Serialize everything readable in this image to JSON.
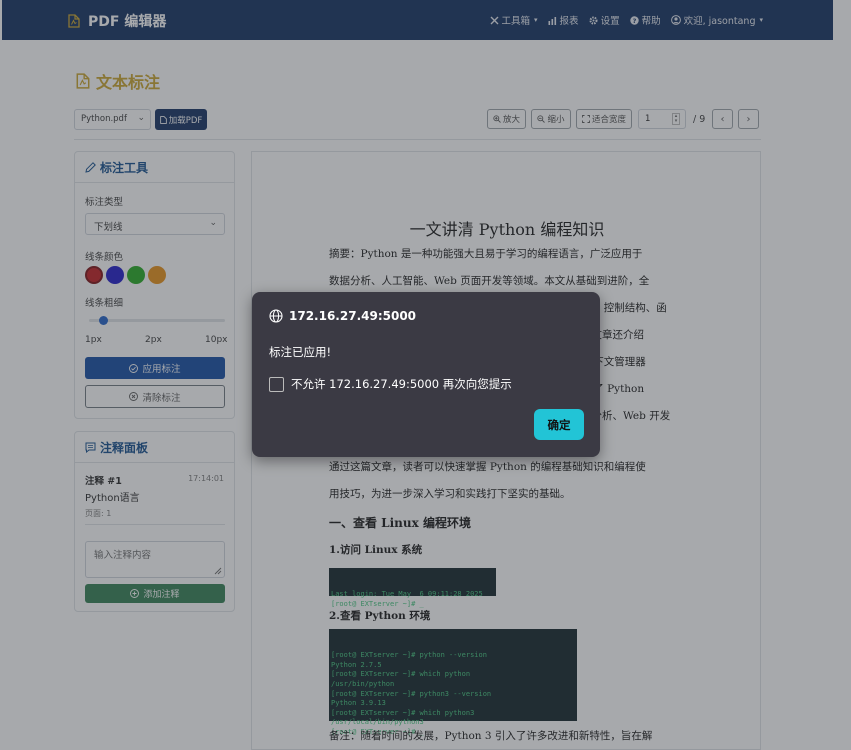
{
  "navbar": {
    "brand": "PDF 编辑器",
    "items": [
      {
        "label": "工具箱",
        "icon": "tools-icon",
        "caret": "▾"
      },
      {
        "label": "报表",
        "icon": "chart-bar-icon"
      },
      {
        "label": "设置",
        "icon": "gear-icon"
      },
      {
        "label": "帮助",
        "icon": "question-circle-icon"
      },
      {
        "label": "欢迎, jasontang",
        "icon": "user-circle-icon",
        "caret": "▾"
      }
    ]
  },
  "page": {
    "title": "文本标注"
  },
  "toolbar": {
    "file_select": "Python.pdf",
    "load_button": "加载PDF",
    "zoom_in": "放大",
    "zoom_out": "缩小",
    "fit_width": "适合宽度",
    "page_value": "1",
    "page_total": "/ 9",
    "prev": "‹",
    "next": "›"
  },
  "annotation_tools": {
    "heading": "标注工具",
    "type_label": "标注类型",
    "type_value": "下划线",
    "color_label": "线条颜色",
    "colors": [
      "#c0161b",
      "#1a14c8",
      "#1fa81c",
      "#e88f12"
    ],
    "width_label": "线条粗细",
    "width_ticks": [
      "1px",
      "2px",
      "10px"
    ],
    "apply_button": "应用标注",
    "clear_button": "清除标注"
  },
  "notes_panel": {
    "heading": "注释面板",
    "note": {
      "title": "注释 #1",
      "time": "17:14:01",
      "text": "Python语言",
      "page": "页面: 1"
    },
    "input_placeholder": "输入注释内容",
    "add_button": "添加注释"
  },
  "document": {
    "title": "一文讲清 Python 编程知识",
    "abstract_lines": [
      "摘要：Python  是一种功能强大且易于学习的编程语言，广泛应用于",
      "数据分析、人工智能、Web 页面开发等领域。本文从基础到进阶，全",
      "面介绍了 Python 的核心知识，包括基础语法、数据类型、控制结构、函",
      "数定义、面向对象编程、模块与包、异常处理等。同时，文章还介绍",
      "了 Python 的高级特性，如生成器、装饰器、迭代器、上下文管理器",
      "等，帮助读者深入理解 Python 的编程思想。此外还探讨了 Python",
      "在实际项目中的应用，例如网络爬虫、自动化脚本、数据分析、Web 开发",
      "等领域的实战案例。"
    ],
    "summary_lines": [
      "通过这篇文章，读者可以快速掌握 Python 的编程基础知识和编程使",
      "用技巧，为进一步深入学习和实践打下坚实的基础。"
    ],
    "section1": "一、查看 Linux 编程环境",
    "sub1": "1.访问 Linux 系统",
    "term1": [
      "Last login: Tue May  6 09:11:28 2025",
      "[root@ EXTserver ~]# _"
    ],
    "sub2": "2.查看 Python 环境",
    "term2": [
      "[root@ EXTserver ~]# python --version",
      "Python 2.7.5",
      "[root@ EXTserver ~]# which python",
      "/usr/bin/python",
      "[root@ EXTserver ~]# python3 --version",
      "Python 3.9.13",
      "[root@ EXTserver ~]# which python3",
      "/usr/local/bin/python3",
      "[root@ EXTserver ~]# _"
    ],
    "note_line": "备注：随着时间的发展，Python 3 引入了许多改进和新特性，旨在解"
  },
  "dialog": {
    "origin": "172.16.27.49:5000",
    "message": "标注已应用!",
    "checkbox_label": "不允许 172.16.27.49:5000 再次向您提示",
    "ok_button": "确定"
  }
}
